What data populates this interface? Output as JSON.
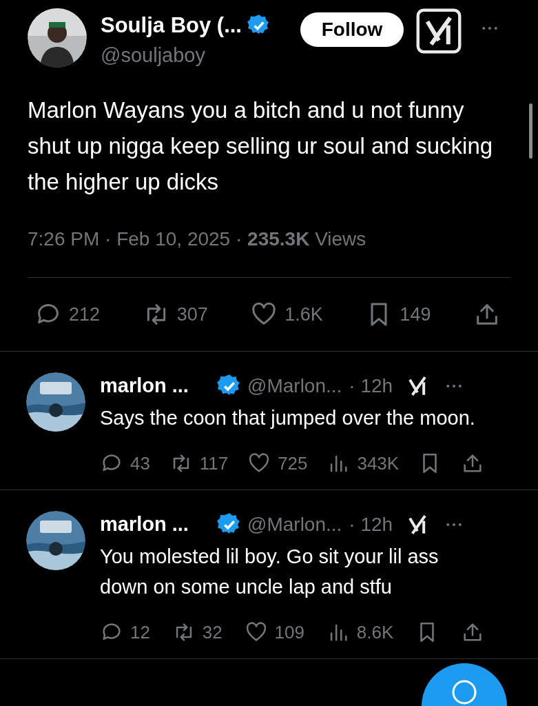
{
  "tweet": {
    "author": {
      "name": "Soulja Boy (...",
      "handle": "@souljaboy",
      "verified": true
    },
    "follow_label": "Follow",
    "text": "Marlon Wayans you a bitch and u not funny shut up nigga keep selling ur soul and sucking the higher up  dicks",
    "meta": "7:26 PM · Feb 10, 2025 · **235.3K** Views",
    "stats": [
      {
        "kind": "reply",
        "count": "212"
      },
      {
        "kind": "repost",
        "count": "307"
      },
      {
        "kind": "like",
        "count": "1.6K"
      },
      {
        "kind": "bookmark",
        "count": "149"
      },
      {
        "kind": "share"
      }
    ]
  },
  "replies": [
    {
      "name": "marlon ...",
      "verified": true,
      "handle": "@Marlon...",
      "time": "· 12h",
      "text": "Says the coon that jumped over the moon.",
      "stats": [
        {
          "kind": "reply",
          "count": "43"
        },
        {
          "kind": "repost",
          "count": "117"
        },
        {
          "kind": "like",
          "count": "725"
        },
        {
          "kind": "views",
          "count": "343K"
        },
        {
          "kind": "bookmark"
        },
        {
          "kind": "share"
        }
      ]
    },
    {
      "name": "marlon ...",
      "verified": true,
      "handle": "@Marlon...",
      "time": "· 12h",
      "text": "You molested lil boy. Go sit your lil ass down on some uncle lap and stfu",
      "stats": [
        {
          "kind": "reply",
          "count": "12"
        },
        {
          "kind": "repost",
          "count": "32"
        },
        {
          "kind": "like",
          "count": "109"
        },
        {
          "kind": "views",
          "count": "8.6K"
        },
        {
          "kind": "bookmark"
        },
        {
          "kind": "share"
        }
      ]
    }
  ]
}
